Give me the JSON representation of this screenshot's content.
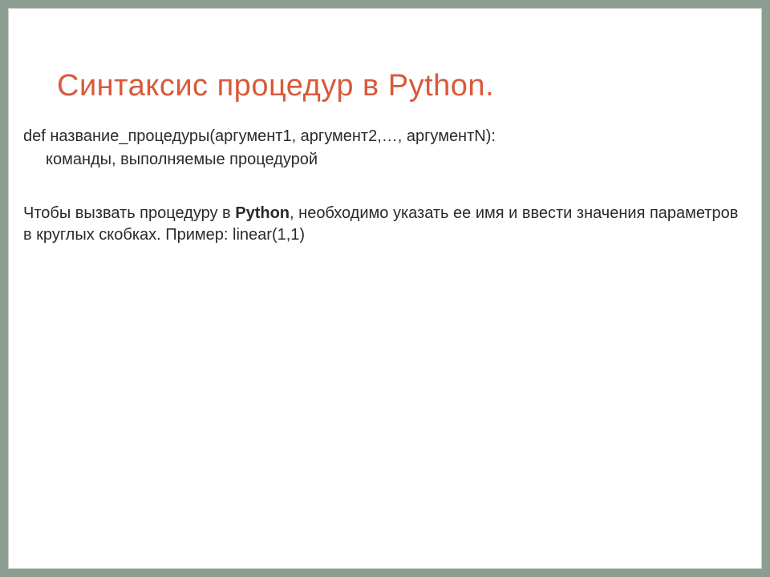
{
  "title": "Синтаксис процедур в Python.",
  "code_line1": "def название_процедуры(аргумент1, аргумент2,…, аргументN):",
  "code_line2": "команды, выполняемые процедурой",
  "para_part1": "Чтобы вызвать процедуру в ",
  "para_bold": "Python",
  "para_part2": ", необходимо указать ее имя и ввести значения параметров в круглых скобках. Пример: linear(1,1)"
}
